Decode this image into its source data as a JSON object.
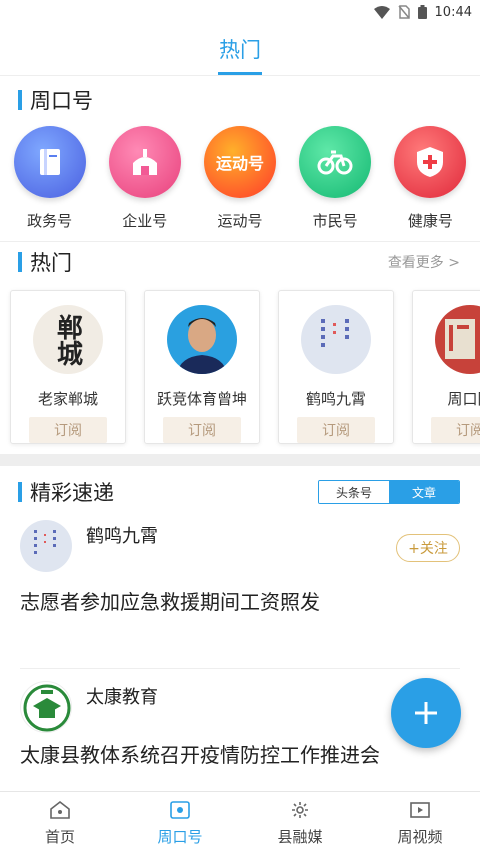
{
  "status": {
    "time": "10:44"
  },
  "header": {
    "title": "热门"
  },
  "channels_section": {
    "title": "周口号"
  },
  "channels": [
    {
      "label": "政务号",
      "icon": "book-icon",
      "color": "#5a7ff0"
    },
    {
      "label": "企业号",
      "icon": "building-icon",
      "color": "#f25a95"
    },
    {
      "label": "运动号",
      "icon": "sport-badge-icon",
      "color": "#ff4f2a",
      "badge": "运动号"
    },
    {
      "label": "市民号",
      "icon": "bicycle-icon",
      "color": "#22c986"
    },
    {
      "label": "健康号",
      "icon": "medical-shield-icon",
      "color": "#ef3c45"
    }
  ],
  "hot_section": {
    "title": "热门",
    "more": "查看更多 >"
  },
  "hot_cards": [
    {
      "name": "老家郸城",
      "subscribe": "订阅",
      "avatar_text": "郸城"
    },
    {
      "name": "跃竞体育曾坤",
      "subscribe": "订阅"
    },
    {
      "name": "鹤鸣九霄",
      "subscribe": "订阅"
    },
    {
      "name": "周口同",
      "subscribe": "订阅"
    }
  ],
  "feed_section": {
    "title": "精彩速递",
    "tabs": [
      "头条号",
      "文章"
    ],
    "active_tab": "文章"
  },
  "posts": [
    {
      "author": "鹤鸣九霄",
      "follow": "+关注",
      "title": "志愿者参加应急救援期间工资照发"
    },
    {
      "author": "太康教育",
      "title": "太康县教体系统召开疫情防控工作推进会"
    }
  ],
  "tabbar": [
    {
      "label": "首页",
      "icon": "home-icon"
    },
    {
      "label": "周口号",
      "icon": "zhoukou-icon",
      "active": true
    },
    {
      "label": "县融媒",
      "icon": "county-media-icon"
    },
    {
      "label": "周视频",
      "icon": "video-icon"
    }
  ],
  "colors": {
    "accent": "#2a9fe6"
  }
}
